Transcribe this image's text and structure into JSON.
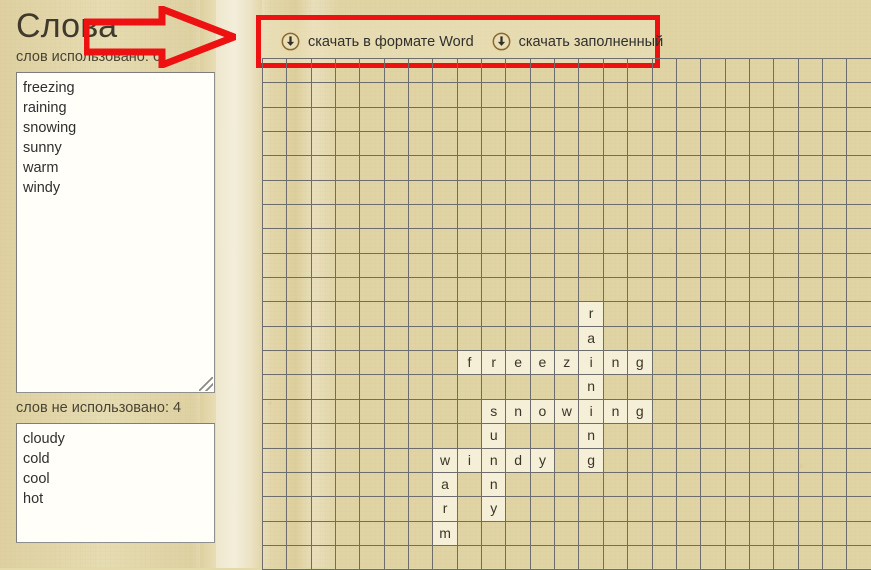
{
  "sidebar": {
    "title": "Слова",
    "used_label": "слов использовано: 6",
    "used_words": [
      "freezing",
      "raining",
      "snowing",
      "sunny",
      "warm",
      "windy"
    ],
    "unused_label": "слов не использовано: 4",
    "unused_words": [
      "cloudy",
      "cold",
      "cool",
      "hot"
    ]
  },
  "toolbar": {
    "download_word_label": "скачать в формате Word",
    "download_filled_label": "скачать заполненный",
    "download_word_icon": "download-circle-icon",
    "download_filled_icon": "download-circle-icon",
    "highlight_color": "#ee1111"
  },
  "annotation": {
    "arrow_icon": "right-arrow-annotation",
    "arrow_color": "#ee1111"
  },
  "crossword": {
    "columns": 25,
    "rows": 21,
    "cell_size": 24,
    "grid_line_color": "#6d6d6d",
    "filled_cell_color": "#f4efd6",
    "entries": [
      {
        "word": "freezing",
        "direction": "across",
        "col": 8,
        "row": 12
      },
      {
        "word": "raining",
        "direction": "down",
        "col": 13,
        "row": 10
      },
      {
        "word": "snowing",
        "direction": "across",
        "col": 9,
        "row": 14
      },
      {
        "word": "sunny",
        "direction": "down",
        "col": 9,
        "row": 14
      },
      {
        "word": "windy",
        "direction": "across",
        "col": 7,
        "row": 16
      },
      {
        "word": "warm",
        "direction": "down",
        "col": 7,
        "row": 16
      }
    ],
    "letters": [
      {
        "col": 13,
        "row": 10,
        "ch": "r"
      },
      {
        "col": 13,
        "row": 11,
        "ch": "a"
      },
      {
        "col": 8,
        "row": 12,
        "ch": "f"
      },
      {
        "col": 9,
        "row": 12,
        "ch": "r"
      },
      {
        "col": 10,
        "row": 12,
        "ch": "e"
      },
      {
        "col": 11,
        "row": 12,
        "ch": "e"
      },
      {
        "col": 12,
        "row": 12,
        "ch": "z"
      },
      {
        "col": 13,
        "row": 12,
        "ch": "i"
      },
      {
        "col": 14,
        "row": 12,
        "ch": "n"
      },
      {
        "col": 15,
        "row": 12,
        "ch": "g"
      },
      {
        "col": 13,
        "row": 13,
        "ch": "n"
      },
      {
        "col": 9,
        "row": 14,
        "ch": "s"
      },
      {
        "col": 10,
        "row": 14,
        "ch": "n"
      },
      {
        "col": 11,
        "row": 14,
        "ch": "o"
      },
      {
        "col": 12,
        "row": 14,
        "ch": "w"
      },
      {
        "col": 13,
        "row": 14,
        "ch": "i"
      },
      {
        "col": 14,
        "row": 14,
        "ch": "n"
      },
      {
        "col": 15,
        "row": 14,
        "ch": "g"
      },
      {
        "col": 9,
        "row": 15,
        "ch": "u"
      },
      {
        "col": 13,
        "row": 15,
        "ch": "n"
      },
      {
        "col": 7,
        "row": 16,
        "ch": "w"
      },
      {
        "col": 8,
        "row": 16,
        "ch": "i"
      },
      {
        "col": 9,
        "row": 16,
        "ch": "n"
      },
      {
        "col": 10,
        "row": 16,
        "ch": "d"
      },
      {
        "col": 11,
        "row": 16,
        "ch": "y"
      },
      {
        "col": 13,
        "row": 16,
        "ch": "g"
      },
      {
        "col": 7,
        "row": 17,
        "ch": "a"
      },
      {
        "col": 9,
        "row": 17,
        "ch": "n"
      },
      {
        "col": 7,
        "row": 18,
        "ch": "r"
      },
      {
        "col": 9,
        "row": 18,
        "ch": "y"
      },
      {
        "col": 7,
        "row": 19,
        "ch": "m"
      }
    ]
  }
}
